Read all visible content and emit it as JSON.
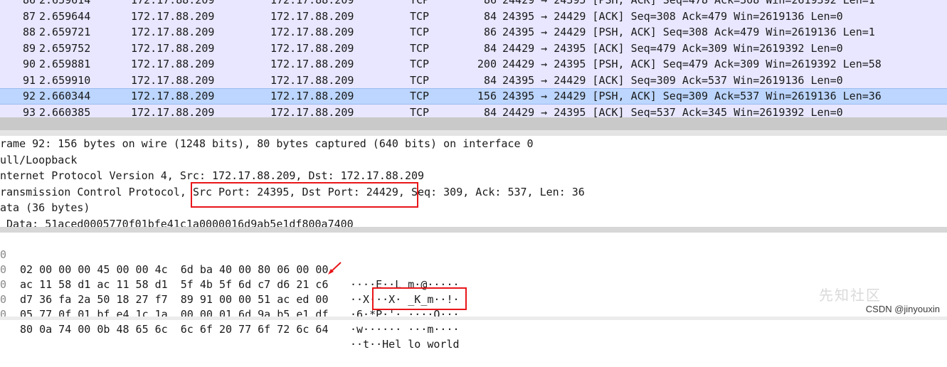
{
  "packet_list": {
    "rows": [
      {
        "no": "86",
        "time": "2.659614",
        "src": "172.17.88.209",
        "dst": "172.17.88.209",
        "proto": "TCP",
        "len": "86",
        "info": "24429 → 24395 [PSH, ACK] Seq=478 Ack=308 Win=2619392 Len=1"
      },
      {
        "no": "87",
        "time": "2.659644",
        "src": "172.17.88.209",
        "dst": "172.17.88.209",
        "proto": "TCP",
        "len": "84",
        "info": "24395 → 24429 [ACK] Seq=308 Ack=479 Win=2619136 Len=0"
      },
      {
        "no": "88",
        "time": "2.659721",
        "src": "172.17.88.209",
        "dst": "172.17.88.209",
        "proto": "TCP",
        "len": "86",
        "info": "24395 → 24429 [PSH, ACK] Seq=308 Ack=479 Win=2619136 Len=1"
      },
      {
        "no": "89",
        "time": "2.659752",
        "src": "172.17.88.209",
        "dst": "172.17.88.209",
        "proto": "TCP",
        "len": "84",
        "info": "24429 → 24395 [ACK] Seq=479 Ack=309 Win=2619392 Len=0"
      },
      {
        "no": "90",
        "time": "2.659881",
        "src": "172.17.88.209",
        "dst": "172.17.88.209",
        "proto": "TCP",
        "len": "200",
        "info": "24429 → 24395 [PSH, ACK] Seq=479 Ack=309 Win=2619392 Len=58"
      },
      {
        "no": "91",
        "time": "2.659910",
        "src": "172.17.88.209",
        "dst": "172.17.88.209",
        "proto": "TCP",
        "len": "84",
        "info": "24395 → 24429 [ACK] Seq=309 Ack=537 Win=2619136 Len=0"
      },
      {
        "no": "92",
        "time": "2.660344",
        "src": "172.17.88.209",
        "dst": "172.17.88.209",
        "proto": "TCP",
        "len": "156",
        "info": "24395 → 24429 [PSH, ACK] Seq=309 Ack=537 Win=2619136 Len=36"
      },
      {
        "no": "93",
        "time": "2.660385",
        "src": "172.17.88.209",
        "dst": "172.17.88.209",
        "proto": "TCP",
        "len": "84",
        "info": "24429 → 24395 [ACK] Seq=537 Ack=345 Win=2619392 Len=0"
      }
    ],
    "selected_no": "92"
  },
  "details": {
    "frame": "rame 92: 156 bytes on wire (1248 bits), 80 bytes captured (640 bits) on interface 0",
    "loopback": "ull/Loopback",
    "ip": "nternet Protocol Version 4, Src: 172.17.88.209, Dst: 172.17.88.209",
    "tcp_prefix": "ransmission Control Protocol, ",
    "tcp_ports": "Src Port: 24395, Dst Port: 24429",
    "tcp_suffix": ", Seq: 309, Ack: 537, Len: 36",
    "data": "ata (36 bytes)",
    "data_value": " Data: 51aced0005770f01bfe41c1a0000016d9ab5e1df800a7400"
  },
  "bytes": {
    "rows": [
      {
        "off": "0",
        "hex": "02 00 00 00 45 00 00 4c  6d ba 40 00 80 06 00 00",
        "ascii": "····E··L m·@·····"
      },
      {
        "off": "0",
        "hex": "ac 11 58 d1 ac 11 58 d1  5f 4b 5f 6d c7 d6 21 c6",
        "ascii": "··X···X· _K_m··!·"
      },
      {
        "off": "0",
        "hex": "d7 36 fa 2a 50 18 27 f7  89 91 00 00 51 ac ed 00",
        "ascii": "·6·*P·'· ····Q···"
      },
      {
        "off": "0",
        "hex": "05 77 0f 01 bf e4 1c 1a  00 00 01 6d 9a b5 e1 df",
        "ascii": "·w······ ···m····"
      },
      {
        "off": "0",
        "hex": "80 0a 74 00 0b 48 65 6c  6c 6f 20 77 6f 72 6c 64",
        "ascii": "··t··Hel lo world"
      }
    ]
  },
  "watermark": "先知社区",
  "credit": "CSDN @jinyouxin",
  "colors": {
    "list_bg": "#e8e7ff",
    "selected_bg": "#bcd6ff",
    "highlight_box": "#e8161a"
  }
}
